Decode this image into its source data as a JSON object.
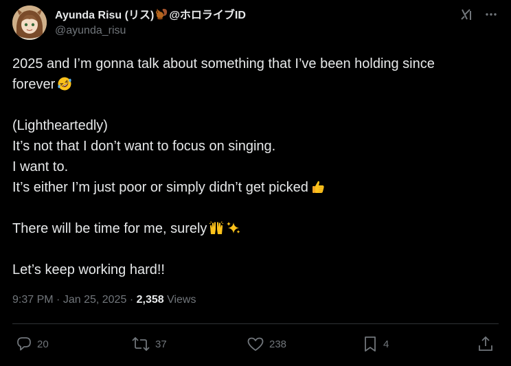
{
  "author": {
    "name": "Ayunda Risu (リス)",
    "affiliation": "@ホロライブID",
    "handle": "@ayunda_risu"
  },
  "top_icons": [
    "grok-icon",
    "more-icon"
  ],
  "tweet": {
    "lines": [
      "2025 and I’m gonna talk about something that I’ve been holding since",
      "forever",
      "",
      "(Lightheartedly)",
      "It’s not that I don’t want to focus on singing.",
      "I want to.",
      "It’s either I’m just poor or simply didn’t get picked",
      "",
      "There will be time for me, surely",
      "",
      "Let’s keep working hard!!"
    ],
    "emoji": {
      "line_1": "rofl-emoji",
      "line_6": "thumbs-up-emoji",
      "line_8": [
        "raising-hands-emoji",
        "sparkles-emoji"
      ]
    }
  },
  "meta": {
    "time": "9:37 PM",
    "date": "Jan 25, 2025",
    "separator": "·",
    "views_count": "2,358",
    "views_label": "Views"
  },
  "actions": {
    "replies": "20",
    "reposts": "37",
    "likes": "238",
    "bookmarks": "4"
  },
  "colors": {
    "background": "#000000",
    "text": "#e7e9ea",
    "secondary": "#71767b",
    "divider": "#2f3336"
  }
}
